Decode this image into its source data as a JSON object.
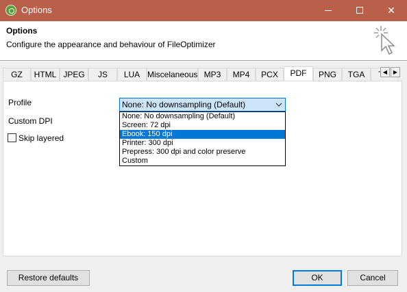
{
  "window": {
    "title": "Options"
  },
  "header": {
    "title": "Options",
    "subtitle": "Configure the appearance and behaviour of FileOptimizer"
  },
  "tabs": [
    {
      "label": "GZ"
    },
    {
      "label": "HTML"
    },
    {
      "label": "JPEG"
    },
    {
      "label": "JS"
    },
    {
      "label": "LUA"
    },
    {
      "label": "Miscelaneous"
    },
    {
      "label": "MP3"
    },
    {
      "label": "MP4"
    },
    {
      "label": "PCX"
    },
    {
      "label": "PDF",
      "active": true
    },
    {
      "label": "PNG"
    },
    {
      "label": "TGA"
    },
    {
      "label": "T"
    }
  ],
  "pdf_panel": {
    "profile_label": "Profile",
    "custom_dpi_label": "Custom DPI",
    "skip_layered_label": "Skip layered",
    "skip_layered_checked": false,
    "profile_value": "None: No downsampling (Default)",
    "profile_options": [
      "None: No downsampling (Default)",
      "Screen: 72 dpi",
      "Ebook: 150 dpi",
      "Printer: 300 dpi",
      "Prepress: 300 dpi and color preserve",
      "Custom"
    ],
    "highlighted_option": "Ebook: 150 dpi"
  },
  "buttons": {
    "restore": "Restore defaults",
    "ok": "OK",
    "cancel": "Cancel"
  },
  "colors": {
    "titlebar": "#b8604a",
    "selection": "#0078d7"
  }
}
